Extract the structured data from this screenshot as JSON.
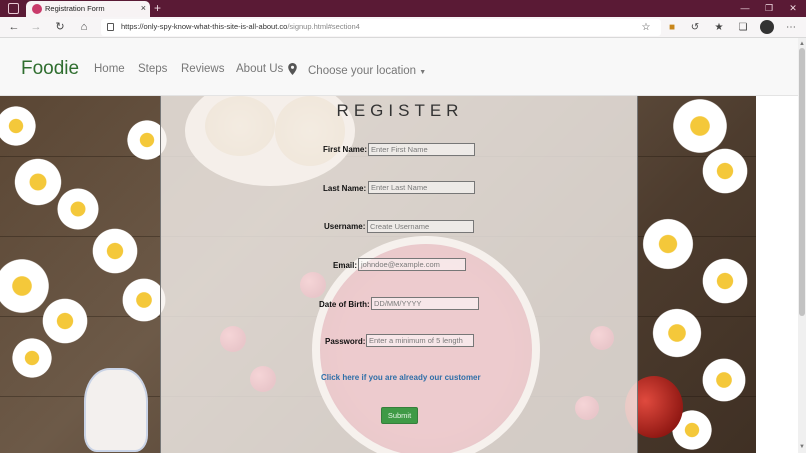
{
  "browser": {
    "tab_title": "Registration Form",
    "new_tab_symbol": "+",
    "tab_close_symbol": "×",
    "url_domain": "https://only-spy-know-what-this-site-is-all-about.co",
    "url_path": "/signup.html#section4",
    "icons": [
      "back-icon",
      "forward-icon",
      "refresh-icon",
      "home-icon",
      "lock-icon",
      "add-favorite-icon",
      "extension-icon",
      "favorites-icon",
      "collections-icon",
      "profile-icon",
      "more-icon",
      "minimize-icon",
      "restore-icon",
      "close-icon"
    ]
  },
  "navbar": {
    "brand": "Foodie",
    "links": [
      "Home",
      "Steps",
      "Reviews",
      "About Us"
    ],
    "location_select": "Choose your location",
    "brand_color": "#2f6e2f"
  },
  "form": {
    "title": "REGISTER",
    "fields": [
      {
        "label": "First Name:",
        "placeholder": "Enter First Name"
      },
      {
        "label": "Last Name:",
        "placeholder": "Enter Last Name"
      },
      {
        "label": "Username:",
        "placeholder": "Create Username"
      },
      {
        "label": "Email:",
        "placeholder": "johndoe@example.com"
      },
      {
        "label": "Date of Birth:",
        "placeholder": "DD/MM/YYYY"
      },
      {
        "label": "Password:",
        "placeholder": "Enter a minimum of 5 length"
      }
    ],
    "existing_customer_link": "Click here if you are already our customer",
    "submit_label": "Submit",
    "submit_color": "#3f9a46",
    "link_color": "#2f6fa8"
  }
}
